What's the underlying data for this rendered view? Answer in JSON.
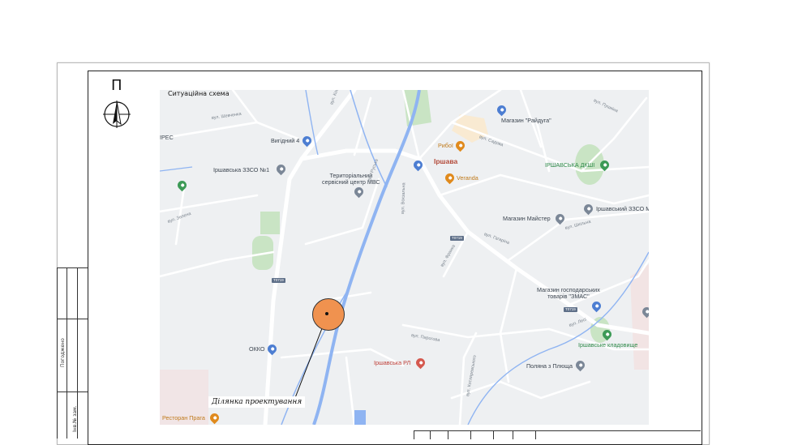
{
  "drawing": {
    "north_letter": "П",
    "map_title": "Ситуаційна схема",
    "site_label": "Ділянка проектування",
    "side_stamp": {
      "label_1": "Погоджено",
      "label_2": "Інв.№ зам."
    }
  },
  "map": {
    "town": "Іршава",
    "places": [
      {
        "id": "vyhidnyi",
        "text": "Вигідний 4",
        "pin": "blue"
      },
      {
        "id": "zzso1",
        "text": "Іршавська ЗЗСО №1",
        "pin": "gray"
      },
      {
        "id": "tsc",
        "text": "Територіальний\nсервісний центр МВС",
        "pin": "gray"
      },
      {
        "id": "raiduha",
        "text": "Магазин \"Райдуга\"",
        "pin": "blue"
      },
      {
        "id": "ryboi",
        "text": "Рибої",
        "pin": "orange"
      },
      {
        "id": "veranda",
        "text": "Veranda",
        "pin": "orange"
      },
      {
        "id": "dkshi",
        "text": "ІРШАВСЬКА ДКШІ",
        "pin": "green"
      },
      {
        "id": "zzso_m",
        "text": "Іршавський ЗЗСО М",
        "pin": "gray"
      },
      {
        "id": "maister",
        "text": "Магазин Майстер",
        "pin": "gray"
      },
      {
        "id": "zmas",
        "text": "Магазин господарських\nтоварів \"ЗМАС\"",
        "pin": "blue"
      },
      {
        "id": "okko",
        "text": "ОККО",
        "pin": "blue"
      },
      {
        "id": "rl",
        "text": "Іршавська РЛ",
        "pin": "red"
      },
      {
        "id": "cemetery",
        "text": "Іршавське кладовище",
        "pin": "green"
      },
      {
        "id": "polyana",
        "text": "Поляна з Плюща",
        "pin": "gray"
      },
      {
        "id": "praha",
        "text": "Ресторан Прага",
        "pin": "orange"
      },
      {
        "id": "ires",
        "text": "ІРЕС",
        "pin": ""
      }
    ],
    "roads": [
      "вул. Шевченка",
      "вул. Коцюбинського",
      "вул. Садова",
      "вул. Пушкіна",
      "вул. Гагаріна",
      "вул. Шкільна",
      "вул. Вокзальна",
      "вул. Руська",
      "вул. Франка",
      "вул. Зелена",
      "вул. Пирогова",
      "вул. Котляревського",
      "вул. Лесі"
    ],
    "route_shields": [
      "T0719",
      "T0719",
      "T0719"
    ],
    "colors": {
      "background": "#eef0f2",
      "road": "#ffffff",
      "river": "#8fb4f2",
      "park": "#c9e4c4",
      "site_fill": "#f0924f"
    }
  }
}
